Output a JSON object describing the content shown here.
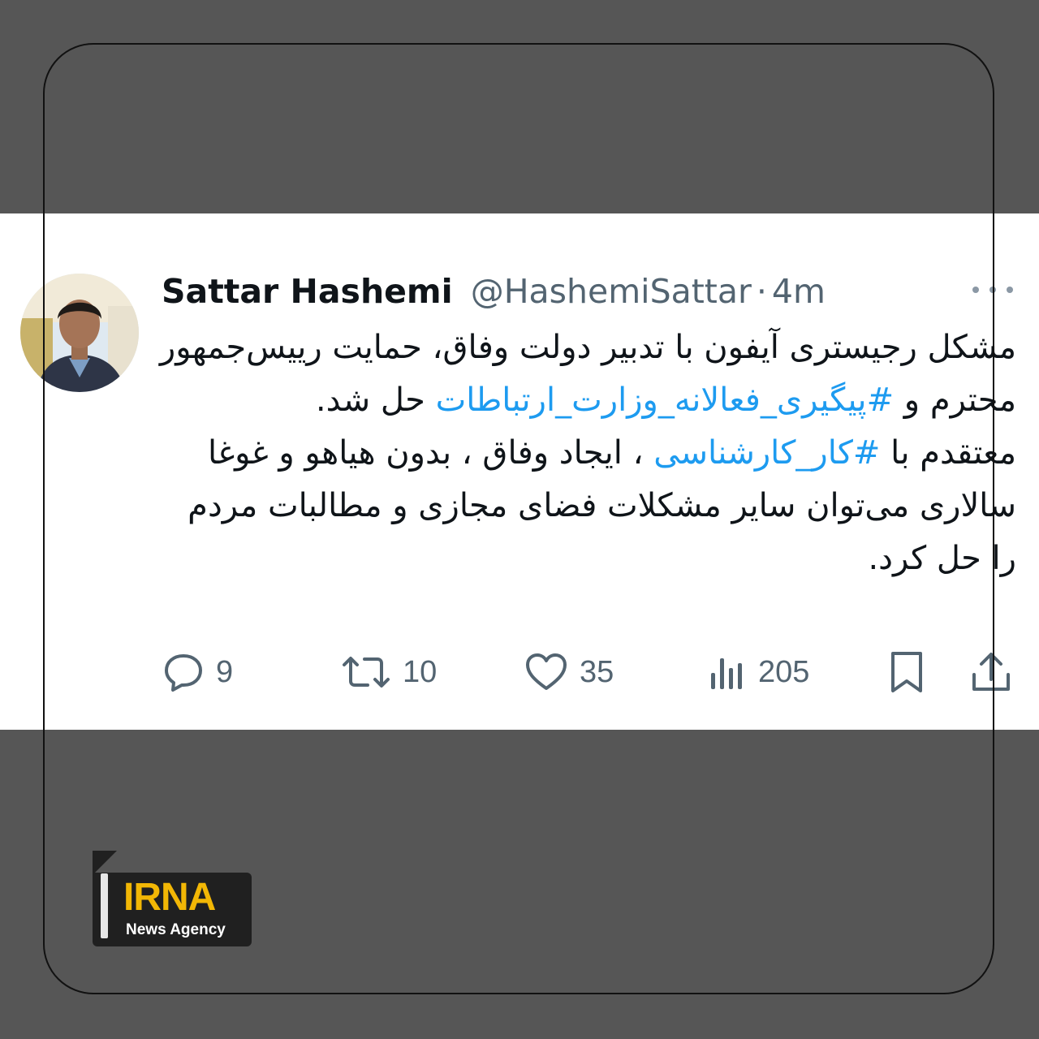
{
  "tweet": {
    "author_name": "Sattar Hashemi",
    "handle": "@HashemiSattar",
    "separator": "·",
    "time": "4m",
    "avatar_icon": "user-avatar-photo",
    "more_icon": "more-dots-icon",
    "text": {
      "p1_before": "مشکل رجیستری آیفون با تدبیر دولت  وفاق، حمایت رییس‌جمهور محترم و ",
      "hashtag1": "#پیگیری_فعالانه_وزارت_ارتباطات",
      "p1_after": " حل شد.",
      "p2_before": "معتقدم با ",
      "hashtag2": "#کار_کارشناسی",
      "p2_after": " ، ایجاد وفاق ، بدون هیاهو و غوغا سالاری می‌توان سایر مشکلات فضای مجازی و مطالبات مردم را حل کرد."
    },
    "stats": {
      "replies": "9",
      "retweets": "10",
      "likes": "35",
      "views": "205"
    },
    "icons": [
      "reply-icon",
      "retweet-icon",
      "like-icon",
      "views-icon",
      "bookmark-icon",
      "share-icon"
    ],
    "colors": {
      "hashtag": "#1d9bf0",
      "muted": "#536471",
      "text": "#0f1419"
    }
  },
  "watermark": {
    "brand": "IRNA",
    "subtitle": "News Agency",
    "colors": {
      "brand": "#f2b705",
      "background": "#202020"
    }
  }
}
